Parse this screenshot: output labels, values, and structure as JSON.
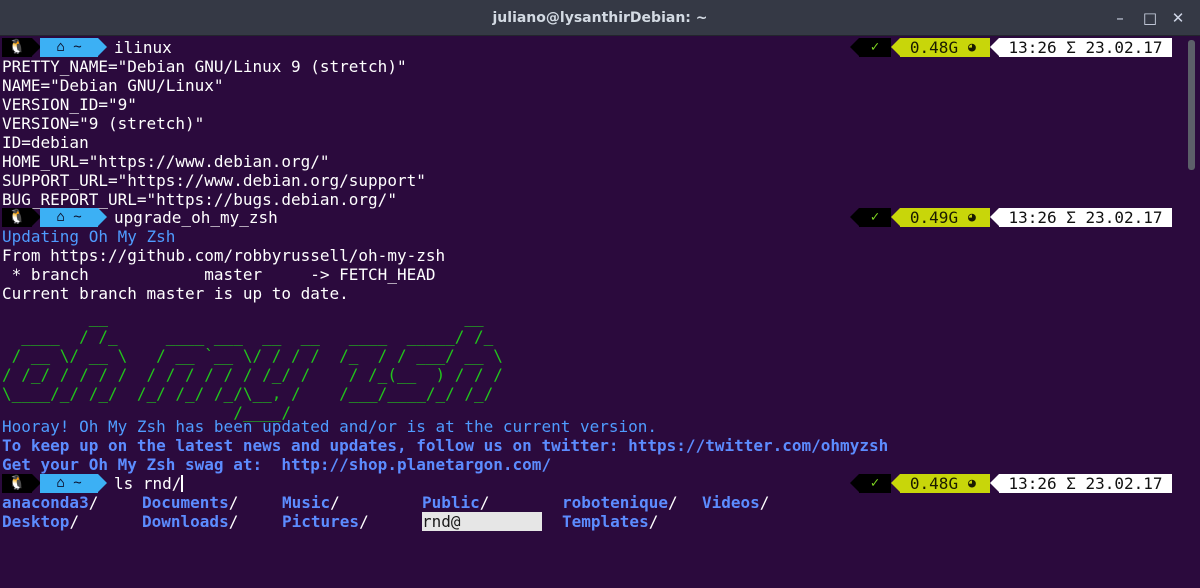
{
  "window": {
    "title": "juliano@lysanthirDebian: ~",
    "buttons": {
      "minimize": "–",
      "maximize": "□",
      "close": "✕"
    }
  },
  "prompt": {
    "tux_icon": "🐧",
    "home_segment": "⌂ ~",
    "status_icon": "✓",
    "meter_icon": "◕"
  },
  "prompts": [
    {
      "command": "ilinux",
      "mem": "0.48G",
      "time": "13:26 Σ 23.02.17"
    },
    {
      "command": "upgrade_oh_my_zsh",
      "mem": "0.49G",
      "time": "13:26 Σ 23.02.17"
    },
    {
      "command": "ls rnd/",
      "mem": "0.48G",
      "time": "13:26 Σ 23.02.17"
    }
  ],
  "os_release": [
    "PRETTY_NAME=\"Debian GNU/Linux 9 (stretch)\"",
    "NAME=\"Debian GNU/Linux\"",
    "VERSION_ID=\"9\"",
    "VERSION=\"9 (stretch)\"",
    "ID=debian",
    "HOME_URL=\"https://www.debian.org/\"",
    "SUPPORT_URL=\"https://www.debian.org/support\"",
    "BUG_REPORT_URL=\"https://bugs.debian.org/\""
  ],
  "update": {
    "updating": "Updating Oh My Zsh",
    "from": "From https://github.com/robbyrussell/oh-my-zsh",
    "branch": " * branch            master     -> FETCH_HEAD",
    "status": "Current branch master is up to date.",
    "logo": [
      "         __                                     __",
      "  ____  / /_     ____ ___  __  __   ____  _____/ /_",
      " / __ \\/ __ \\   / __ `__ \\/ / / /  /_  / / ___/ __ \\",
      "/ /_/ / / / /  / / / / / / /_/ /    / /_(__  ) / / /",
      "\\____/_/ /_/  /_/ /_/ /_/\\__, /    /___/____/_/ /_/",
      "                        /____/"
    ],
    "hooray": "Hooray! Oh My Zsh has been updated and/or is at the current version.",
    "twitter": "To keep up on the latest news and updates, follow us on twitter: https://twitter.com/ohmyzsh",
    "swag": "Get your Oh My Zsh swag at:  http://shop.planetargon.com/"
  },
  "ls_output": {
    "row1": [
      "anaconda3",
      "Documents",
      "Music",
      "Public",
      "robotenique",
      "Videos"
    ],
    "row2": [
      "Desktop",
      "Downloads",
      "Pictures",
      "rnd@",
      "Templates"
    ],
    "slash": "/"
  }
}
